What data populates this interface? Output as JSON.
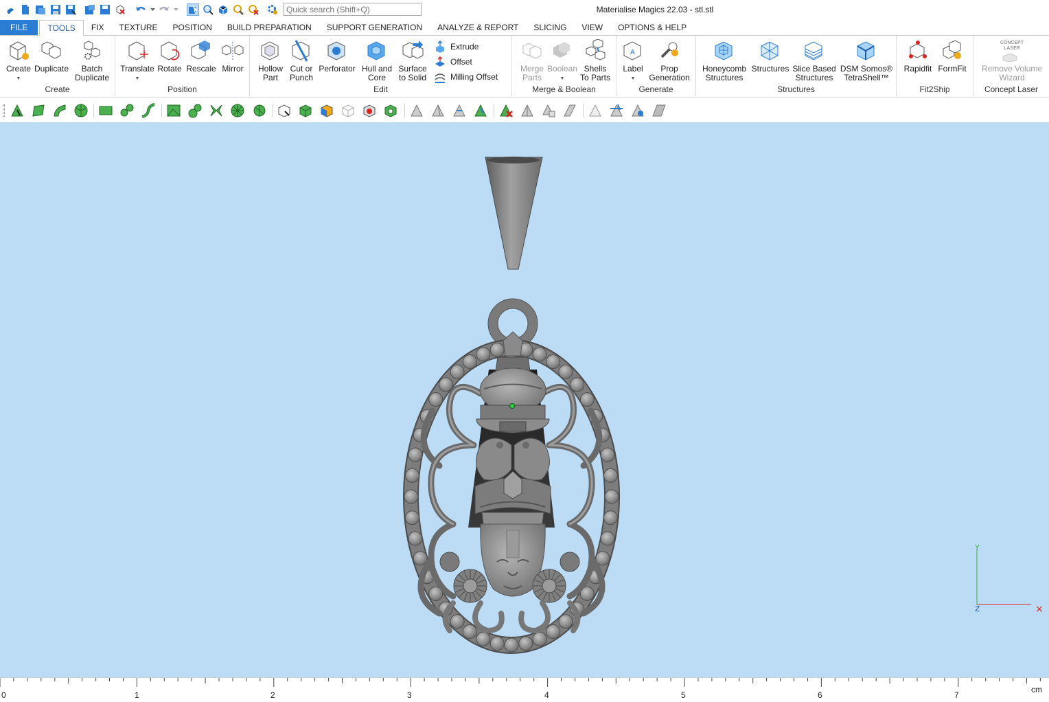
{
  "window": {
    "title": "Materialise Magics 22.03 - stl.stl"
  },
  "quick_access": {
    "icons": [
      "magics-logo-icon",
      "new-file-icon",
      "open-file-icon",
      "save-icon",
      "save-as-icon",
      "import-icon",
      "export-icon",
      "close-part-icon",
      "undo-icon",
      "redo-icon",
      "select-mode-icon",
      "zoom-select-icon",
      "view-part-icon",
      "zoom-icon",
      "zoom-reset-icon",
      "settings-icon"
    ],
    "search_placeholder": "Quick search (Shift+Q)"
  },
  "tabs": [
    {
      "label": "FILE",
      "kind": "file"
    },
    {
      "label": "TOOLS",
      "kind": "active"
    },
    {
      "label": "FIX"
    },
    {
      "label": "TEXTURE"
    },
    {
      "label": "POSITION"
    },
    {
      "label": "BUILD PREPARATION"
    },
    {
      "label": "SUPPORT GENERATION"
    },
    {
      "label": "ANALYZE & REPORT"
    },
    {
      "label": "SLICING"
    },
    {
      "label": "VIEW"
    },
    {
      "label": "OPTIONS & HELP"
    }
  ],
  "ribbon": {
    "create": {
      "label": "Create",
      "create": "Create",
      "duplicate": "Duplicate",
      "batch1": "Batch",
      "batch2": "Duplicate"
    },
    "position": {
      "label": "Position",
      "translate": "Translate",
      "rotate": "Rotate",
      "rescale": "Rescale",
      "mirror": "Mirror"
    },
    "edit": {
      "label": "Edit",
      "hollow1": "Hollow",
      "hollow2": "Part",
      "cut1": "Cut or",
      "cut2": "Punch",
      "perforator": "Perforator",
      "hull1": "Hull and",
      "hull2": "Core",
      "surface1": "Surface",
      "surface2": "to Solid",
      "extrude": "Extrude",
      "offset": "Offset",
      "milling": "Milling Offset"
    },
    "merge": {
      "label": "Merge & Boolean",
      "merge1": "Merge",
      "merge2": "Parts",
      "boolean": "Boolean",
      "shells1": "Shells",
      "shells2": "To Parts"
    },
    "generate": {
      "label": "Generate",
      "label_btn": "Label",
      "prop1": "Prop",
      "prop2": "Generation"
    },
    "structures": {
      "label": "Structures",
      "honey1": "Honeycomb",
      "honey2": "Structures",
      "structures": "Structures",
      "slice1": "Slice Based",
      "slice2": "Structures",
      "dsm1": "DSM Somos®",
      "dsm2": "TetraShell™"
    },
    "fit2ship": {
      "label": "Fit2Ship",
      "rapidfit": "Rapidfit",
      "formfit": "FormFit"
    },
    "concept": {
      "label": "Concept Laser",
      "rv1": "Remove Volume",
      "rv2": "Wizard",
      "badge1": "CONCEPT",
      "badge2": "LASER"
    }
  },
  "toolbar2": {
    "icons": [
      "select-triangle-icon",
      "select-surface-icon",
      "select-curve-icon",
      "select-shell-icon",
      "select-plane-icon",
      "select-cylinder-icon",
      "select-cone-icon",
      "select-box-icon",
      "select-sphere-icon",
      "select-flag-icon",
      "select-marked-icon",
      "select-bad-icon",
      "view-front-icon",
      "view-back-icon",
      "view-color-icon",
      "view-wire-icon",
      "view-shaded-icon",
      "view-cube-icon",
      "triangle-mark-icon",
      "triangle-expand-icon",
      "triangle-shrink-icon",
      "triangle-grow-icon",
      "triangle-delete-icon",
      "triangle-invert-icon",
      "triangle-copy-icon",
      "triangle-flat-icon",
      "triangle-hide-icon",
      "triangle-split-icon",
      "triangle-view-icon",
      "triangle-plane-icon"
    ]
  },
  "axes": {
    "y": "Y",
    "z": "Z",
    "x": "×"
  },
  "ruler": {
    "ticks": [
      "0",
      "1",
      "2",
      "3",
      "4",
      "5",
      "6",
      "7"
    ],
    "unit": "cm"
  },
  "colors": {
    "viewport_bg": "#bcdcf6",
    "model": "#8a8a8a",
    "accent": "#2b7cd3"
  }
}
